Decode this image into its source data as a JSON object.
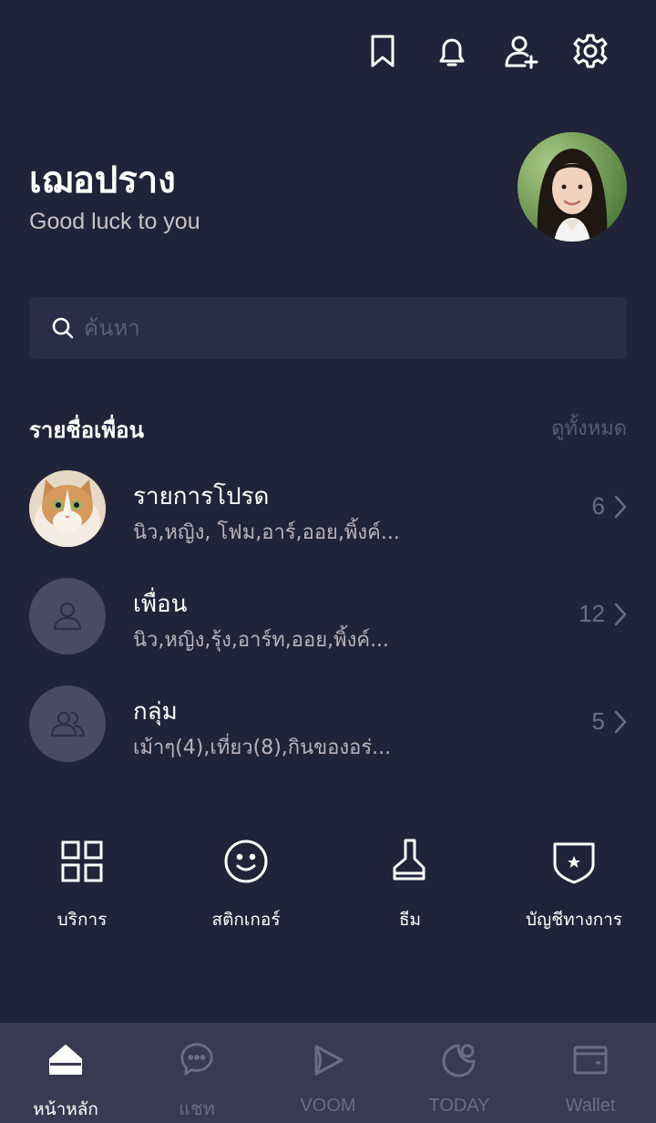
{
  "colors": {
    "background": "#212339",
    "surface": "#2b2d46",
    "nav_background": "#393a52",
    "muted": "#6a6c83"
  },
  "topbar": {
    "icons": [
      "bookmark-icon",
      "bell-icon",
      "add-friend-icon",
      "gear-icon"
    ]
  },
  "profile": {
    "name": "เฌอปราง",
    "status": "Good luck to you"
  },
  "search": {
    "placeholder": "ค้นหา",
    "value": ""
  },
  "friends_section": {
    "title": "รายชื่อเพื่อน",
    "see_all": "ดูทั้งหมด",
    "rows": [
      {
        "title": "รายการโปรด",
        "subtitle": "นิว,หญิง, โฟม,อาร์,ออย,พิ้งค์...",
        "count": "6",
        "icon": "cat-avatar"
      },
      {
        "title": "เพื่อน",
        "subtitle": "นิว,หญิง,รุ้ง,อาร์ท,ออย,พิ้งค์...",
        "count": "12",
        "icon": "person-icon"
      },
      {
        "title": "กลุ่ม",
        "subtitle": "เม้าๆ(4),เที่ยว(8),กินของอร่...",
        "count": "5",
        "icon": "group-icon"
      }
    ]
  },
  "shortcuts": [
    {
      "label": "บริการ",
      "icon": "grid-icon"
    },
    {
      "label": "สติกเกอร์",
      "icon": "smiley-icon"
    },
    {
      "label": "ธีม",
      "icon": "brush-icon"
    },
    {
      "label": "บัญชีทางการ",
      "icon": "shield-star-icon"
    }
  ],
  "bottom_nav": [
    {
      "label": "หน้าหลัก",
      "icon": "home-icon",
      "active": true
    },
    {
      "label": "แชท",
      "icon": "chat-icon",
      "active": false
    },
    {
      "label": "VOOM",
      "icon": "voom-icon",
      "active": false
    },
    {
      "label": "TODAY",
      "icon": "today-icon",
      "active": false
    },
    {
      "label": "Wallet",
      "icon": "wallet-icon",
      "active": false
    }
  ]
}
